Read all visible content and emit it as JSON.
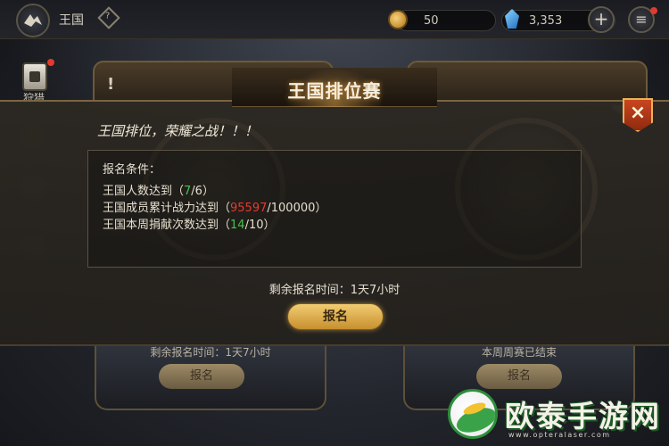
{
  "topbar": {
    "kingdom_label": "王国",
    "coins": "50",
    "gems": "3,353"
  },
  "sidebar": {
    "hunt_label": "狩猎"
  },
  "cards": {
    "left": {
      "status": "剩余报名时间：1天7小时",
      "button": "报名"
    },
    "right": {
      "status": "本周周赛已结束",
      "button": "报名"
    }
  },
  "modal": {
    "title": "王国排位赛",
    "headline": "王国排位，荣耀之战！！！",
    "requirements_title": "报名条件：",
    "requirements": [
      {
        "prefix": "王国人数达到（",
        "current": "7",
        "target": "/6",
        "suffix": "）",
        "met": true
      },
      {
        "prefix": "王国成员累计战力达到（",
        "current": "95597",
        "target": "/100000",
        "suffix": "）",
        "met": false
      },
      {
        "prefix": "王国本周捐献次数达到（",
        "current": "14",
        "target": "/10",
        "suffix": "）",
        "met": true
      }
    ],
    "deadline": "剩余报名时间：1天7小时",
    "signup_button": "报名",
    "close_symbol": "×"
  },
  "watermark": {
    "brand": "欧泰手游网",
    "url": "www.opteralaser.com"
  },
  "colors": {
    "met": "#49c24d",
    "unmet": "#e43a2f",
    "accent_gold": "#e0a94a"
  },
  "icons": [
    "kingdom-emblem-icon",
    "diamond-help-icon",
    "coin-icon",
    "gem-icon",
    "plus-icon",
    "menu-icon",
    "hunt-icon",
    "warning-icon",
    "close-icon"
  ]
}
